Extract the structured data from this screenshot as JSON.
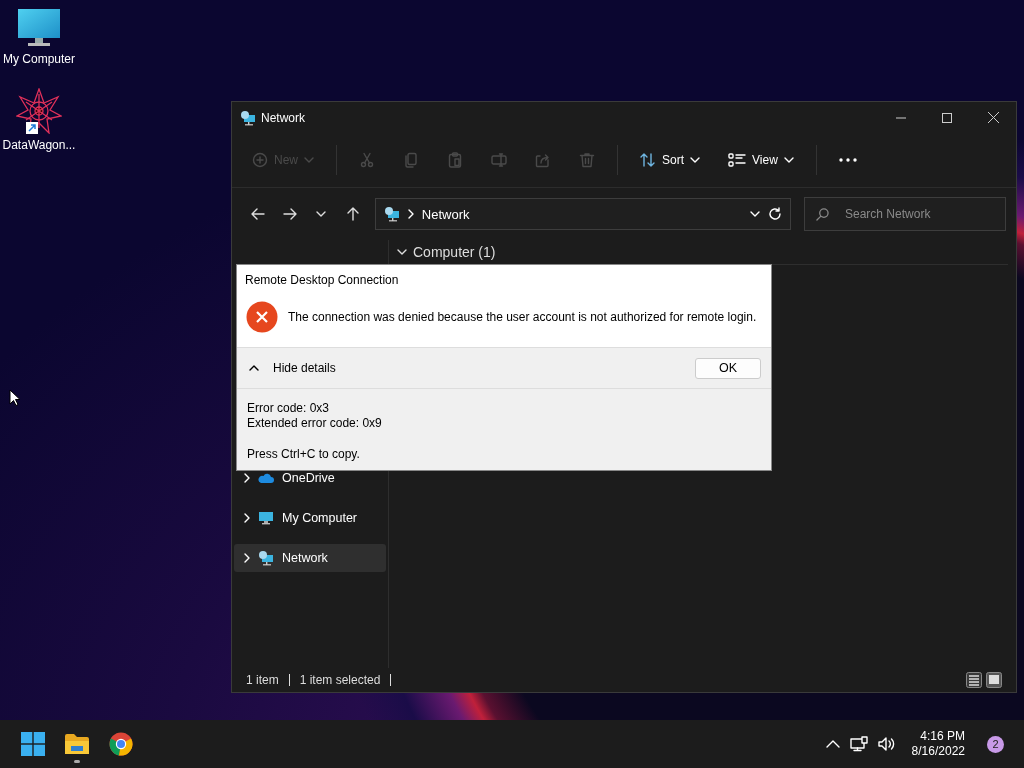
{
  "desktop_icons": [
    {
      "label": "My Computer",
      "kind": "computer"
    },
    {
      "label": "DataWagon...",
      "kind": "shortcut"
    }
  ],
  "explorer": {
    "title": "Network",
    "toolbar": [
      {
        "kind": "new",
        "label": "New",
        "disabled": true
      },
      {
        "kind": "cut",
        "disabled": true
      },
      {
        "kind": "copy",
        "disabled": true
      },
      {
        "kind": "paste",
        "disabled": true
      },
      {
        "kind": "rename",
        "disabled": true
      },
      {
        "kind": "share",
        "disabled": true
      },
      {
        "kind": "delete",
        "disabled": true
      },
      {
        "kind": "sort",
        "label": "Sort",
        "disabled": false
      },
      {
        "kind": "view",
        "label": "View",
        "disabled": false
      },
      {
        "kind": "more",
        "disabled": false
      }
    ],
    "address": "Network",
    "search": {
      "placeholder": "Search Network"
    },
    "group": {
      "label": "Computer (1)",
      "expanded": true
    },
    "sidebar": [
      {
        "label": "OneDrive",
        "kind": "cloud",
        "selected": false
      },
      {
        "label": "My Computer",
        "kind": "computer",
        "selected": false
      },
      {
        "label": "Network",
        "kind": "network",
        "selected": true
      }
    ],
    "status": [
      "1 item",
      "1 item selected"
    ],
    "views": [
      {
        "kind": "details",
        "selected": false
      },
      {
        "kind": "tiles",
        "selected": true
      }
    ]
  },
  "dialog": {
    "title": "Remote Desktop Connection",
    "message": "The connection was denied because the user account is not authorized for remote login.",
    "details_toggle": {
      "label": "Hide details",
      "expanded": true
    },
    "button": "OK",
    "detail_lines": [
      "Error code: 0x3",
      "Extended error code: 0x9"
    ],
    "copy_hint": "Press Ctrl+C to copy."
  },
  "taskbar": {
    "apps": [
      {
        "kind": "start",
        "running": false
      },
      {
        "kind": "explorer",
        "running": true
      },
      {
        "kind": "browser",
        "running": false
      }
    ],
    "time": "4:16 PM",
    "date": "8/16/2022",
    "notifications": "2"
  }
}
